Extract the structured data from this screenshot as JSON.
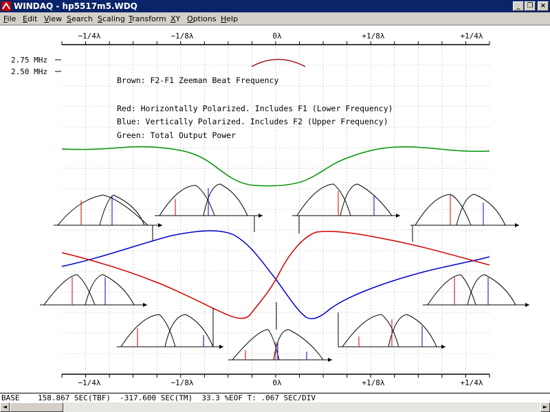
{
  "window": {
    "app_name": "WINDAQ",
    "title": "WINDAQ - hp5517m5.WDQ",
    "buttons": {
      "minimize": "_",
      "restore": "❐",
      "close": "×"
    }
  },
  "menu": [
    {
      "label": "File",
      "underline": "F",
      "rest": "ile"
    },
    {
      "label": "Edit",
      "underline": "E",
      "rest": "dit"
    },
    {
      "label": "View",
      "underline": "V",
      "rest": "iew"
    },
    {
      "label": "Search",
      "underline": "S",
      "rest": "earch"
    },
    {
      "label": "Scaling",
      "underline": "S",
      "rest": "caling"
    },
    {
      "label": "Transform",
      "underline": "T",
      "rest": "ransform"
    },
    {
      "label": "XY",
      "underline": "X",
      "rest": "Y"
    },
    {
      "label": "Options",
      "underline": "O",
      "rest": "ptions"
    },
    {
      "label": "Help",
      "underline": "H",
      "rest": "elp"
    }
  ],
  "plot": {
    "x_axis_labels": [
      "−1/4λ",
      "−1/8λ",
      "0λ",
      "+1/8λ",
      "+1/4λ"
    ],
    "y_axis_labels": [
      "2.75 MHz",
      "2.50 MHz"
    ],
    "legend": [
      "Brown: F2-F1 Zeeman Beat Frequency",
      "Red: Horizontally Polarized. Includes F1 (Lower Frequency)",
      "Blue: Vertically Polarized. Includes F2 (Upper Frequency)",
      "Green: Total Output Power"
    ],
    "colors": {
      "brown": "#a01818",
      "red": "#d00000",
      "blue": "#0000c8",
      "green": "#009000",
      "grid": "#808080"
    }
  },
  "status": {
    "text": "BASE    158.867 SEC(TBF)  -317.600 SEC(TM)  33.3 %EOF T: .067 SEC/DIV"
  },
  "scrollbar": {
    "left_arrow": "◄",
    "right_arrow": "►"
  }
}
